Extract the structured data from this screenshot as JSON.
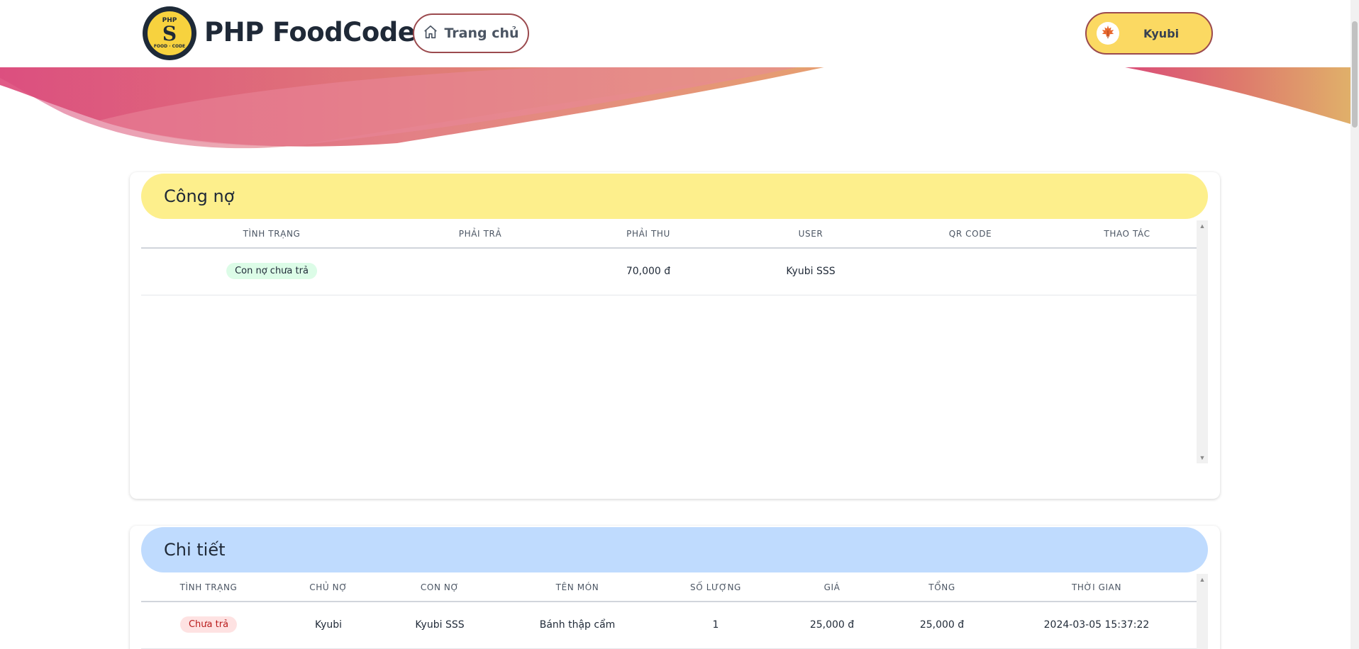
{
  "header": {
    "logo": {
      "top_text": "PHP",
      "mark": "S",
      "bottom_text": "FOOD · CODE"
    },
    "brand": "PHP FoodCode",
    "home_button": {
      "label": "Trang chủ",
      "icon": "home-icon"
    },
    "user_button": {
      "name": "Kyubi",
      "avatar_icon": "maple-leaf-icon"
    }
  },
  "debt_card": {
    "title": "Công nợ",
    "columns": [
      "TÌNH TRẠNG",
      "PHẢI TRẢ",
      "PHẢI THU",
      "USER",
      "QR CODE",
      "THAO TÁC"
    ],
    "rows": [
      {
        "status": "Con nợ chưa trả",
        "must_pay": "",
        "receivable": "70,000 đ",
        "user": "Kyubi SSS",
        "qr_code": "",
        "action": ""
      }
    ]
  },
  "detail_card": {
    "title": "Chi tiết",
    "columns": [
      "TÌNH TRẠNG",
      "CHỦ NỢ",
      "CON NỢ",
      "TÊN MÓN",
      "SỐ LƯỢNG",
      "GIÁ",
      "TỔNG",
      "THỜI GIAN"
    ],
    "rows": [
      {
        "status": "Chưa trả",
        "creditor": "Kyubi",
        "debtor": "Kyubi SSS",
        "dish": "Bánh thập cẩm",
        "quantity": "1",
        "price": "25,000 đ",
        "total": "25,000 đ",
        "time": "2024-03-05 15:37:22"
      }
    ]
  },
  "colors": {
    "debt_header": "#fdef8c",
    "detail_header": "#bfdbfe",
    "user_button": "#fbd962",
    "button_border": "#9b4a4e",
    "wave_start": "#d9467a",
    "wave_end": "#e0b06a"
  }
}
